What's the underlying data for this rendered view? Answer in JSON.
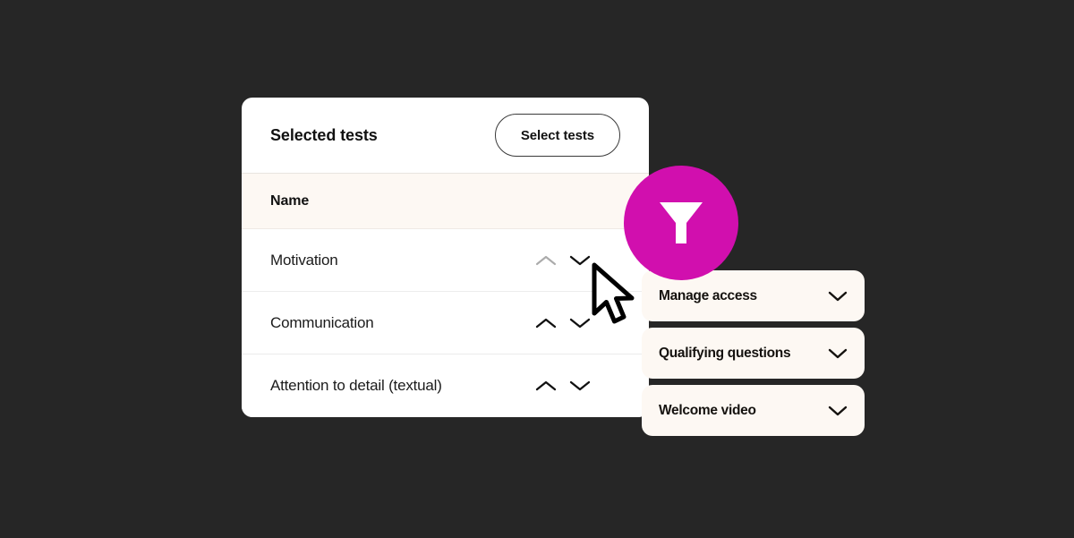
{
  "theme": {
    "page_background": "#262626",
    "card_background": "#ffffff",
    "panel_background": "#FDF8F3",
    "accent_magenta": "#D10FAE",
    "text_primary": "#111111",
    "disabled_arrow": "#ABABAB",
    "divider": "#ECECEC"
  },
  "tests_card": {
    "title": "Selected tests",
    "select_button_label": "Select tests",
    "column_header": "Name",
    "rows": [
      {
        "name": "Motivation",
        "move_up_enabled": false,
        "move_down_enabled": true
      },
      {
        "name": "Communication",
        "move_up_enabled": true,
        "move_down_enabled": true
      },
      {
        "name": "Attention to detail (textual)",
        "move_up_enabled": true,
        "move_down_enabled": true
      }
    ]
  },
  "filter_badge": {
    "icon": "funnel-filter-icon"
  },
  "accordion_panels": [
    {
      "label": "Manage access",
      "icon": "chevron-down-icon",
      "expanded": false
    },
    {
      "label": "Qualifying questions",
      "icon": "chevron-down-icon",
      "expanded": false
    },
    {
      "label": "Welcome video",
      "icon": "chevron-down-icon",
      "expanded": false
    }
  ],
  "pointer": {
    "icon": "mouse-arrow-cursor"
  }
}
